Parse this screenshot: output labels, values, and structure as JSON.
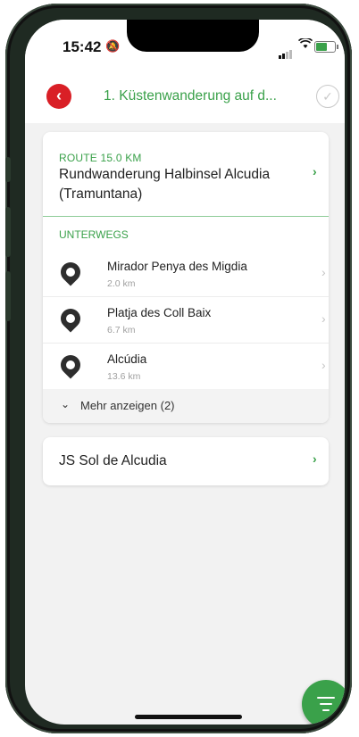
{
  "status_bar": {
    "time": "15:42"
  },
  "nav": {
    "title": "1. Küstenwanderung auf d..."
  },
  "route": {
    "label": "ROUTE 15.0 KM",
    "name": "Rundwanderung Halbinsel Alcudia (Tramuntana)"
  },
  "stops_section": {
    "label": "UNTERWEGS",
    "items": [
      {
        "name": "Mirador Penya des Migdia",
        "distance": "2.0 km"
      },
      {
        "name": "Platja des Coll Baix",
        "distance": "6.7 km"
      },
      {
        "name": "Alcúdia",
        "distance": "13.6 km"
      }
    ],
    "more_label": "Mehr anzeigen (2)"
  },
  "accommodation": {
    "name": "JS Sol de Alcudia"
  },
  "colors": {
    "accent": "#3aa14a",
    "back_button": "#d91f26"
  },
  "icons": [
    "back-arrow-icon",
    "checkmark-circle-icon",
    "chevron-right-icon",
    "location-pin-icon",
    "chevron-down-icon",
    "filter-icon",
    "bell-slash-icon",
    "wifi-icon",
    "battery-icon"
  ]
}
